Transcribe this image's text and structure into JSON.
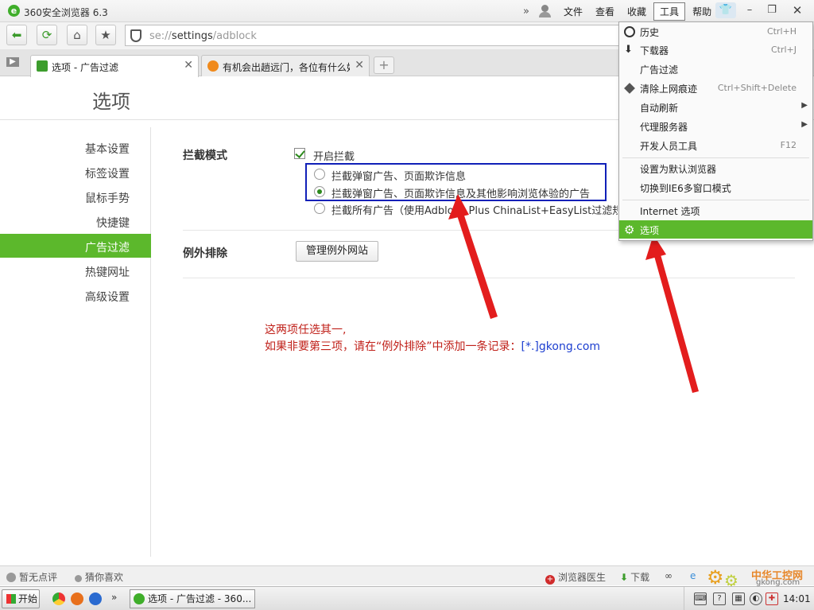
{
  "window": {
    "title": "360安全浏览器 6.3"
  },
  "menubar": [
    "文件",
    "查看",
    "收藏",
    "工具",
    "帮助"
  ],
  "window_controls": {
    "minimize": "–",
    "maximize": "❐",
    "close": "✕"
  },
  "address": {
    "scheme": "se://",
    "host": "settings",
    "path": "/adblock"
  },
  "tabs": [
    {
      "label": "选项 - 广告过滤",
      "active": true
    },
    {
      "label": "有机会出趟远门，各位有什么好",
      "active": false
    }
  ],
  "new_tab": "+",
  "page": {
    "title": "选项"
  },
  "sidebar": [
    {
      "label": "基本设置"
    },
    {
      "label": "标签设置"
    },
    {
      "label": "鼠标手势"
    },
    {
      "label": "快捷键"
    },
    {
      "label": "广告过滤",
      "active": true
    },
    {
      "label": "热键网址"
    },
    {
      "label": "高级设置"
    }
  ],
  "adblock": {
    "mode_label": "拦截模式",
    "enable_label": "开启拦截",
    "options": [
      {
        "label": "拦截弹窗广告、页面欺诈信息",
        "checked": false
      },
      {
        "label": "拦截弹窗广告、页面欺诈信息及其他影响浏览体验的广告",
        "checked": true
      },
      {
        "label": "拦截所有广告（使用Adblock Plus ChinaList+EasyList过滤规则）",
        "checked": false
      }
    ],
    "exception_label": "例外排除",
    "manage_button": "管理例外网站"
  },
  "annotation": {
    "line1": "这两项任选其一,",
    "line2": "如果非要第三项，请在“例外排除”中添加一条记录：",
    "link": "[*.]gkong.com",
    "color": "#c0211a"
  },
  "tools_menu": [
    {
      "label": "历史",
      "shortcut": "Ctrl+H",
      "icon": "clock-icon"
    },
    {
      "label": "下载器",
      "shortcut": "Ctrl+J",
      "icon": "download-icon"
    },
    {
      "label": "广告过滤",
      "shortcut": ""
    },
    {
      "label": "清除上网痕迹",
      "shortcut": "Ctrl+Shift+Delete",
      "icon": "eraser-icon"
    },
    {
      "label": "自动刷新",
      "submenu": true
    },
    {
      "label": "代理服务器",
      "submenu": true
    },
    {
      "label": "开发人员工具",
      "shortcut": "F12"
    },
    {
      "label": "设置为默认浏览器"
    },
    {
      "label": "切换到IE6多窗口模式"
    },
    {
      "label": "Internet 选项"
    },
    {
      "label": "选项",
      "icon": "gear-icon",
      "highlighted": true
    }
  ],
  "statusbar": {
    "rating": "暂无点评",
    "guess": "猜你喜欢",
    "doctor": "浏览器医生",
    "download": "下载"
  },
  "watermark": {
    "title": "中华工控网",
    "url": "gkong.com"
  },
  "taskbar": {
    "start": "开始",
    "more": "»",
    "task": "选项 - 广告过滤 - 360...",
    "clock": "14:01"
  },
  "accent_color": "#5cb82c"
}
